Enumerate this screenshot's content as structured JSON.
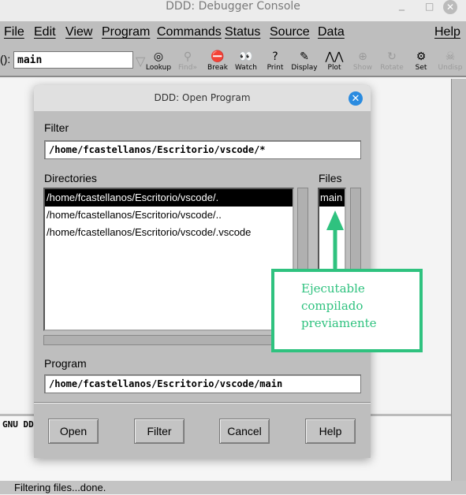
{
  "window": {
    "title": "DDD: Debugger Console"
  },
  "menubar": [
    "File",
    "Edit",
    "View",
    "Program",
    "Commands",
    "Status",
    "Source",
    "Data",
    "Help"
  ],
  "toolbar": {
    "arg_label": "():",
    "arg_value": "main",
    "buttons": [
      {
        "label": "Lookup",
        "icon": "lookup-icon",
        "glyph": "◎"
      },
      {
        "label": "Find»",
        "icon": "find-icon",
        "glyph": "⚲"
      },
      {
        "label": "Break",
        "icon": "stop-sign-icon",
        "glyph": "⛔"
      },
      {
        "label": "Watch",
        "icon": "eyes-icon",
        "glyph": "👀"
      },
      {
        "label": "Print",
        "icon": "question-icon",
        "glyph": "?"
      },
      {
        "label": "Display",
        "icon": "display-icon",
        "glyph": "✎"
      },
      {
        "label": "Plot",
        "icon": "plot-icon",
        "glyph": "⋀⋀"
      },
      {
        "label": "Show",
        "icon": "magnifier-icon",
        "glyph": "⊕"
      },
      {
        "label": "Rotate",
        "icon": "rotate-icon",
        "glyph": "↻"
      },
      {
        "label": "Set",
        "icon": "gear-icon",
        "glyph": "⚙"
      },
      {
        "label": "Undisp",
        "icon": "skull-icon",
        "glyph": "☠"
      }
    ]
  },
  "console": {
    "text": "GNU DD"
  },
  "status": "Filtering files...done.",
  "dialog": {
    "title": "DDD: Open Program",
    "filter_label": "Filter",
    "filter_value": "/home/fcastellanos/Escritorio/vscode/*",
    "directories_label": "Directories",
    "directories": [
      "/home/fcastellanos/Escritorio/vscode/.",
      "/home/fcastellanos/Escritorio/vscode/..",
      "/home/fcastellanos/Escritorio/vscode/.vscode"
    ],
    "files_label": "Files",
    "files": [
      "main"
    ],
    "program_label": "Program",
    "program_value": "/home/fcastellanos/Escritorio/vscode/main",
    "buttons": {
      "open": "Open",
      "filter": "Filter",
      "cancel": "Cancel",
      "help": "Help"
    }
  },
  "annotation": {
    "lines": [
      "Ejecutable",
      "compilado",
      "previamente"
    ],
    "color": "#2fc27f"
  }
}
